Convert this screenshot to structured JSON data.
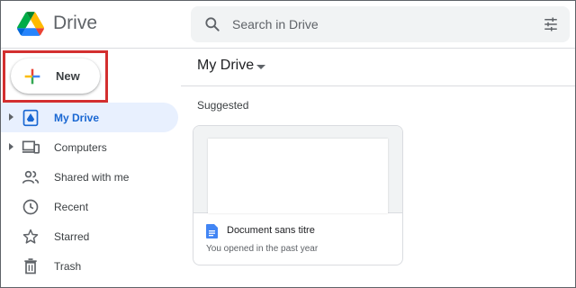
{
  "app": {
    "brand": "Drive",
    "icon": "google-drive-logo"
  },
  "search": {
    "placeholder": "Search in Drive",
    "icon": "search-icon",
    "filter_icon": "tune-icon"
  },
  "new_button": {
    "label": "New",
    "icon": "plus-icon"
  },
  "sidebar": {
    "items": [
      {
        "label": "My Drive",
        "icon": "my-drive-icon",
        "expandable": true,
        "active": true
      },
      {
        "label": "Computers",
        "icon": "computers-icon",
        "expandable": true,
        "active": false
      },
      {
        "label": "Shared with me",
        "icon": "shared-icon",
        "expandable": false,
        "active": false
      },
      {
        "label": "Recent",
        "icon": "clock-icon",
        "expandable": false,
        "active": false
      },
      {
        "label": "Starred",
        "icon": "star-icon",
        "expandable": false,
        "active": false
      },
      {
        "label": "Trash",
        "icon": "trash-icon",
        "expandable": false,
        "active": false
      }
    ]
  },
  "main": {
    "title": "My Drive",
    "section": "Suggested",
    "files": [
      {
        "name": "Document sans titre",
        "subtitle": "You opened in the past year",
        "icon": "google-docs-icon"
      }
    ]
  },
  "colors": {
    "accent": "#1967d2",
    "active_bg": "#e8f0fe",
    "highlight_border": "#d32f2f"
  }
}
